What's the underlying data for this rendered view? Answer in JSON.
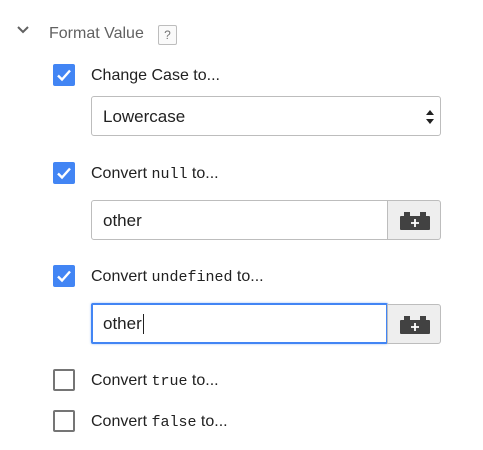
{
  "section": {
    "title": "Format Value",
    "help_label": "?"
  },
  "options": [
    {
      "prefix": "Change Case to...",
      "code": "",
      "suffix": "",
      "checked": true
    },
    {
      "prefix": "Convert ",
      "code": "null",
      "suffix": " to...",
      "checked": true
    },
    {
      "prefix": "Convert ",
      "code": "undefined",
      "suffix": " to...",
      "checked": true
    },
    {
      "prefix": "Convert ",
      "code": "true",
      "suffix": " to...",
      "checked": false
    },
    {
      "prefix": "Convert ",
      "code": "false",
      "suffix": " to...",
      "checked": false
    }
  ],
  "case_select": {
    "value": "Lowercase"
  },
  "null_input": {
    "value": "other"
  },
  "undefined_input": {
    "value": "other"
  },
  "colors": {
    "accent": "#4285f4",
    "border": "#bdbdbd"
  },
  "icons": {
    "collapse": "chevron-down-icon",
    "variable": "variable-brick-icon"
  }
}
